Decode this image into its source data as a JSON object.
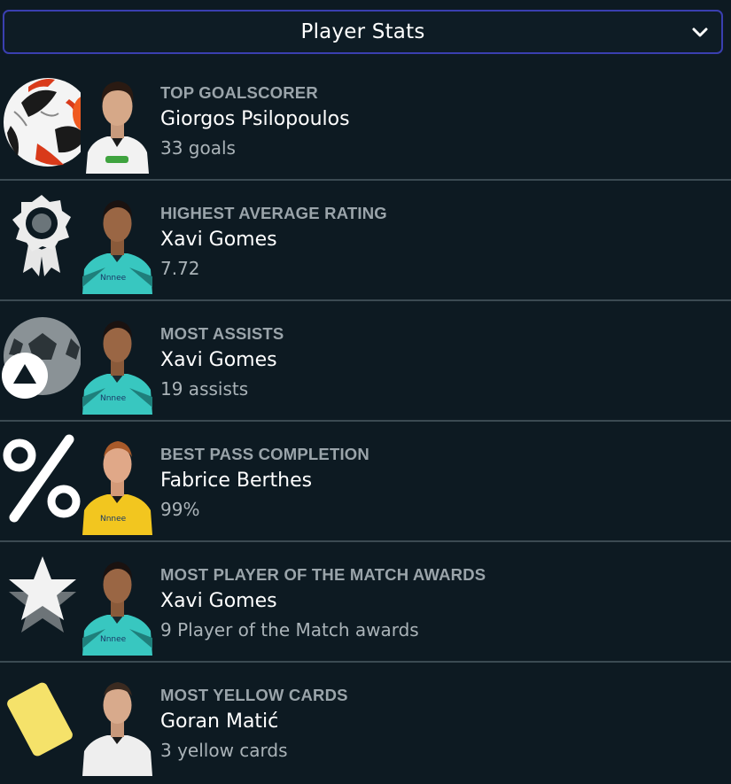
{
  "header": {
    "title": "Player Stats",
    "chevron_icon": "chevron-down-icon"
  },
  "colors": {
    "background": "#0d1a22",
    "header_border": "#3a3fb0",
    "divider": "#3b4a52",
    "category_text": "#9aa4aa",
    "name_text": "#ffffff",
    "value_text": "#aab3b8"
  },
  "stats": [
    {
      "category": "TOP GOALSCORER",
      "player": "Giorgos Psilopoulos",
      "value": "33 goals",
      "icon": "football-icon",
      "kit": "white"
    },
    {
      "category": "HIGHEST AVERAGE RATING",
      "player": "Xavi Gomes",
      "value": "7.72",
      "icon": "award-rosette-icon",
      "kit": "teal"
    },
    {
      "category": "MOST ASSISTS",
      "player": "Xavi Gomes",
      "value": "19 assists",
      "icon": "assist-ball-icon",
      "kit": "teal"
    },
    {
      "category": "BEST PASS COMPLETION",
      "player": "Fabrice Berthes",
      "value": "99%",
      "icon": "percent-icon",
      "kit": "yellow"
    },
    {
      "category": "MOST PLAYER OF THE MATCH AWARDS",
      "player": "Xavi Gomes",
      "value": "9 Player of the Match awards",
      "icon": "star-icon",
      "kit": "teal"
    },
    {
      "category": "MOST YELLOW CARDS",
      "player": "Goran Matić",
      "value": "3 yellow cards",
      "icon": "yellow-card-icon",
      "kit": "white"
    }
  ]
}
